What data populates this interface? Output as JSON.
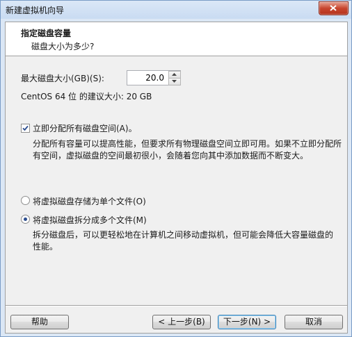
{
  "window": {
    "title": "新建虚拟机向导"
  },
  "header": {
    "title": "指定磁盘容量",
    "subtitle": "磁盘大小为多少?"
  },
  "disk": {
    "max_size_label": "最大磁盘大小(GB)(S):",
    "max_size_value": "20.0",
    "recommended_text": "CentOS 64 位 的建议大小: 20 GB"
  },
  "allocate": {
    "checked": true,
    "label": "立即分配所有磁盘空间(A)。",
    "description": "分配所有容量可以提高性能，但要求所有物理磁盘空间立即可用。如果不立即分配所有空间，虚拟磁盘的空间最初很小，会随着您向其中添加数据而不断变大。"
  },
  "storage": {
    "selected": "multiple",
    "single_label": "将虚拟磁盘存储为单个文件(O)",
    "multiple_label": "将虚拟磁盘拆分成多个文件(M)",
    "multiple_description": "拆分磁盘后，可以更轻松地在计算机之间移动虚拟机，但可能会降低大容量磁盘的性能。"
  },
  "buttons": {
    "help": "帮助",
    "back": "< 上一步(B)",
    "next": "下一步(N) >",
    "cancel": "取消"
  }
}
